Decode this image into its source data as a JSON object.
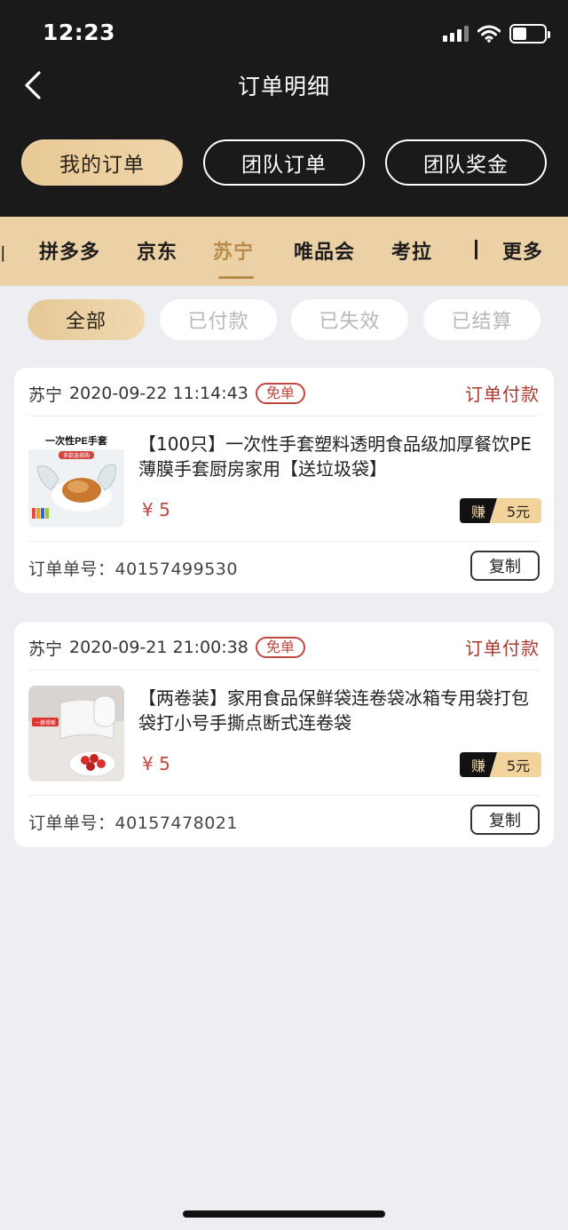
{
  "status_bar": {
    "time": "12:23"
  },
  "header": {
    "title": "订单明细"
  },
  "segments": [
    {
      "label": "我的订单",
      "active": true
    },
    {
      "label": "团队订单",
      "active": false
    },
    {
      "label": "团队奖金",
      "active": false
    }
  ],
  "platforms": {
    "items": [
      {
        "label": "拼多多",
        "active": false
      },
      {
        "label": "京东",
        "active": false
      },
      {
        "label": "苏宁",
        "active": true
      },
      {
        "label": "唯品会",
        "active": false
      },
      {
        "label": "考拉",
        "active": false
      }
    ],
    "more": "更多"
  },
  "filters": [
    {
      "label": "全部",
      "active": true
    },
    {
      "label": "已付款",
      "active": false
    },
    {
      "label": "已失效",
      "active": false
    },
    {
      "label": "已结算",
      "active": false
    }
  ],
  "orders": [
    {
      "store": "苏宁",
      "time": "2020-09-22 11:14:43",
      "badge": "免单",
      "status": "订单付款",
      "thumb_text": "一次性PE手套",
      "thumb_sub": "多款选择购",
      "title": "【100只】一次性手套塑料透明食品级加厚餐饮PE薄膜手套厨房家用【送垃圾袋】",
      "price": "¥ 5",
      "earn_label": "赚",
      "earn_value": "5元",
      "order_label": "订单单号：",
      "order_no": "40157499530",
      "copy": "复制"
    },
    {
      "store": "苏宁",
      "time": "2020-09-21 21:00:38",
      "badge": "免单",
      "status": "订单付款",
      "thumb_text": "一撕得断",
      "title": "【两卷装】家用食品保鲜袋连卷袋冰箱专用袋打包袋打小号手撕点断式连卷袋",
      "price": "¥ 5",
      "earn_label": "赚",
      "earn_value": "5元",
      "order_label": "订单单号：",
      "order_no": "40157478021",
      "copy": "复制"
    }
  ],
  "colors": {
    "gold": "#edd1a6",
    "accent": "#b98a4a",
    "status_red": "#a8392e",
    "dark": "#1a1a1a"
  }
}
